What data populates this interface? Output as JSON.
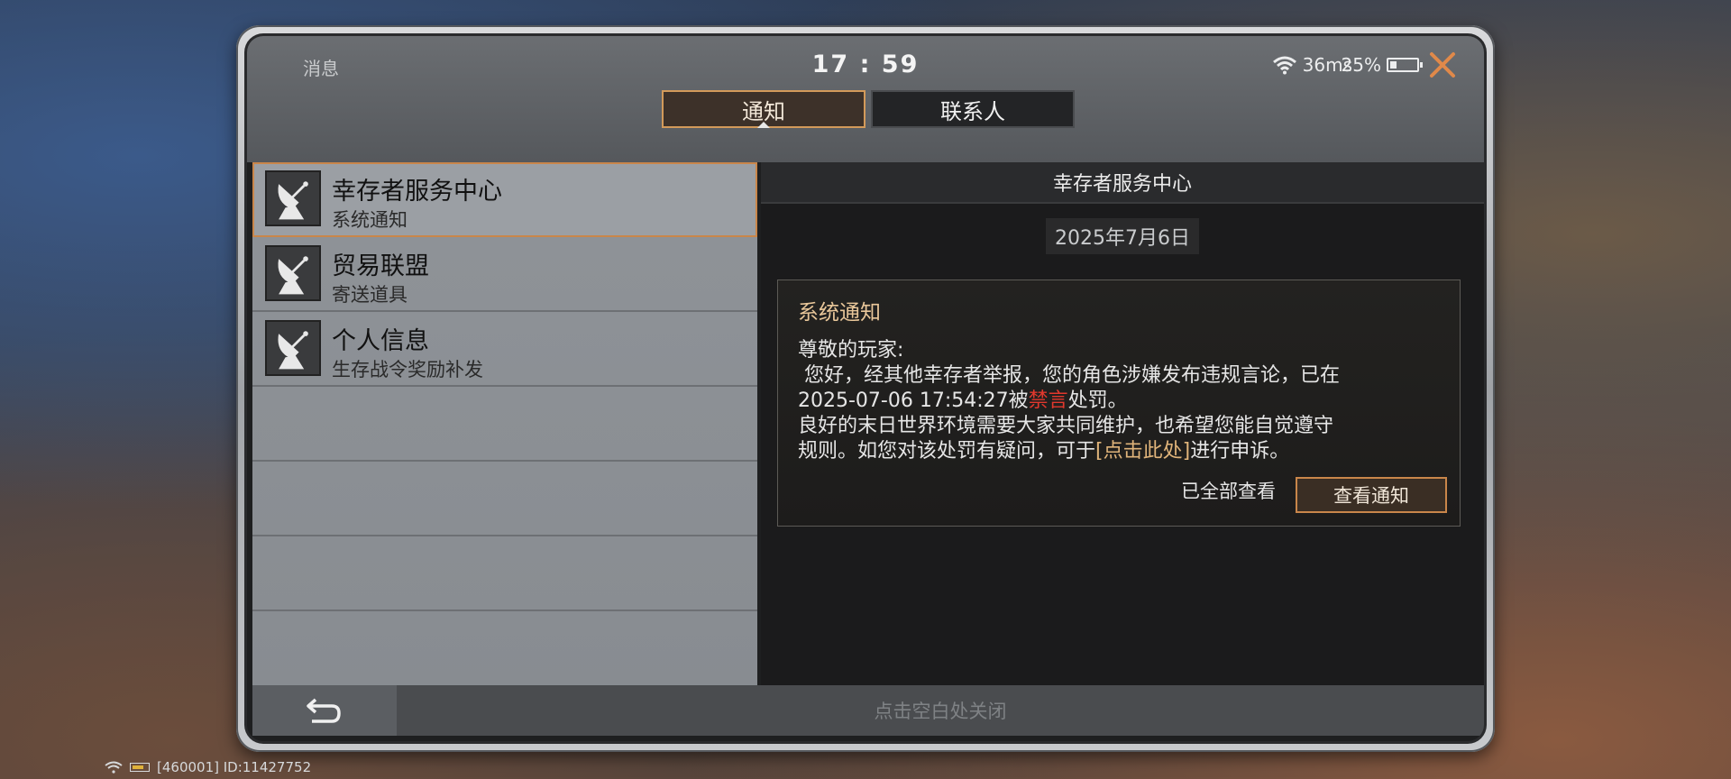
{
  "header": {
    "title": "消息",
    "clock": "17 : 59",
    "ping": "36ms",
    "battery": "25%",
    "battery_level": 0.25
  },
  "tabs": [
    {
      "label": "通知",
      "active": true
    },
    {
      "label": "联系人",
      "active": false
    }
  ],
  "list": {
    "items": [
      {
        "title": "幸存者服务中心",
        "subtitle": "系统通知",
        "icon": "satellite-dish-icon",
        "selected": true
      },
      {
        "title": "贸易联盟",
        "subtitle": "寄送道具",
        "icon": "satellite-dish-icon",
        "selected": false
      },
      {
        "title": "个人信息",
        "subtitle": "生存战令奖励补发",
        "icon": "satellite-dish-icon",
        "selected": false
      }
    ]
  },
  "detail": {
    "header": "幸存者服务中心",
    "date": "2025年7月6日",
    "card": {
      "title": "系统通知",
      "greeting": "尊敬的玩家:",
      "line1": " 您好，经其他幸存者举报，您的角色涉嫌发布违规言论，已在",
      "line2_prefix": "2025-07-06 17:54:27被",
      "line2_red": "禁言",
      "line2_suffix": "处罚。",
      "line3": "良好的末日世界环境需要大家共同维护，也希望您能自觉遵守",
      "line4_prefix": "规则。如您对该处罚有疑问，可于",
      "line4_link": "[点击此处]",
      "line4_suffix": "进行申诉。",
      "viewed_label": "已全部查看",
      "view_button": "查看通知"
    }
  },
  "bottom": {
    "close_hint": "点击空白处关闭"
  },
  "footer": {
    "id_text": "[460001] ID:11427752"
  },
  "colors": {
    "accent": "#c9864a",
    "highlight_red": "#e2382d",
    "link_gold": "#e0b47a"
  }
}
